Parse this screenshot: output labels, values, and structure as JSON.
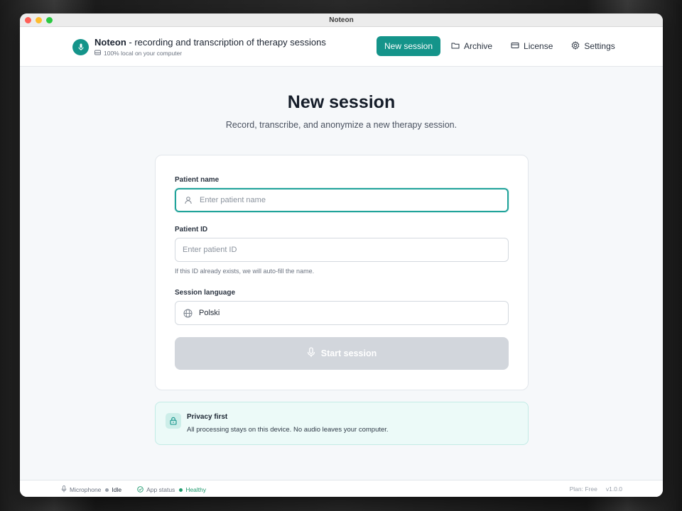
{
  "window": {
    "title": "Noteon"
  },
  "brand": {
    "name": "Noteon",
    "tagline": " - recording and transcription of therapy sessions",
    "sub": "100% local on your computer"
  },
  "nav": {
    "new_session": "New session",
    "archive": "Archive",
    "license": "License",
    "settings": "Settings"
  },
  "page": {
    "title": "New session",
    "subtitle": "Record, transcribe, and anonymize a new therapy session."
  },
  "form": {
    "patient_name_label": "Patient name",
    "patient_name_placeholder": "Enter patient name",
    "patient_id_label": "Patient ID",
    "patient_id_placeholder": "Enter patient ID",
    "patient_id_hint": "If this ID already exists, we will auto-fill the name.",
    "language_label": "Session language",
    "language_value": "Polski",
    "start_button": "Start session"
  },
  "privacy": {
    "title": "Privacy first",
    "text": "All processing stays on this device. No audio leaves your computer."
  },
  "status": {
    "microphone_label": "Microphone",
    "microphone_value": "Idle",
    "app_status_label": "App status",
    "app_status_value": "Healthy",
    "plan": "Plan: Free",
    "version": "v1.0.0"
  },
  "colors": {
    "accent": "#14948a",
    "focus_border": "#20a39a",
    "disabled_button": "#d2d6dc",
    "healthy": "#1f9a6e"
  }
}
